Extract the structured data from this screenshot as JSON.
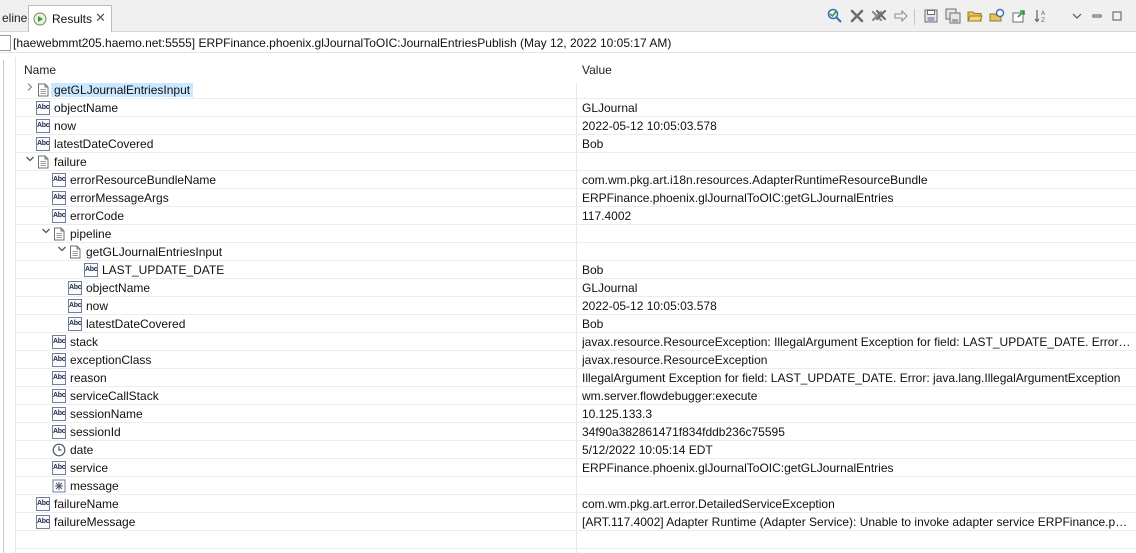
{
  "tabs": {
    "previous_label": "eline",
    "active_label": "Results",
    "close_glyph": "✕"
  },
  "path": {
    "text": "[haewebmmt205.haemo.net:5555] ERPFinance.phoenix.glJournalToOIC:JournalEntriesPublish (May 12, 2022 10:05:17 AM)"
  },
  "table": {
    "headers": {
      "name": "Name",
      "value": "Value"
    },
    "rows": [
      {
        "depth": 0,
        "twist": "collapsed",
        "icon": "document",
        "name": "getGLJournalEntriesInput",
        "value": "",
        "selected": true
      },
      {
        "depth": 0,
        "twist": "none",
        "icon": "abc",
        "name": "objectName",
        "value": "GLJournal"
      },
      {
        "depth": 0,
        "twist": "none",
        "icon": "abc",
        "name": "now",
        "value": "2022-05-12 10:05:03.578"
      },
      {
        "depth": 0,
        "twist": "none",
        "icon": "abc",
        "name": "latestDateCovered",
        "value": "Bob"
      },
      {
        "depth": 0,
        "twist": "expanded",
        "icon": "document",
        "name": "failure",
        "value": ""
      },
      {
        "depth": 1,
        "twist": "none",
        "icon": "abc",
        "name": "errorResourceBundleName",
        "value": "com.wm.pkg.art.i18n.resources.AdapterRuntimeResourceBundle"
      },
      {
        "depth": 1,
        "twist": "none",
        "icon": "abc",
        "name": "errorMessageArgs",
        "value": "ERPFinance.phoenix.glJournalToOIC:getGLJournalEntries"
      },
      {
        "depth": 1,
        "twist": "none",
        "icon": "abc",
        "name": "errorCode",
        "value": "117.4002"
      },
      {
        "depth": 1,
        "twist": "expanded",
        "icon": "document",
        "name": "pipeline",
        "value": ""
      },
      {
        "depth": 2,
        "twist": "expanded",
        "icon": "document",
        "name": "getGLJournalEntriesInput",
        "value": ""
      },
      {
        "depth": 3,
        "twist": "none",
        "icon": "abc",
        "name": "LAST_UPDATE_DATE",
        "value": "Bob"
      },
      {
        "depth": 2,
        "twist": "none",
        "icon": "abc",
        "name": "objectName",
        "value": "GLJournal"
      },
      {
        "depth": 2,
        "twist": "none",
        "icon": "abc",
        "name": "now",
        "value": "2022-05-12 10:05:03.578"
      },
      {
        "depth": 2,
        "twist": "none",
        "icon": "abc",
        "name": "latestDateCovered",
        "value": "Bob"
      },
      {
        "depth": 1,
        "twist": "none",
        "icon": "abc",
        "name": "stack",
        "value": "javax.resource.ResourceException: IllegalArgument Exception for field: LAST_UPDATE_DATE. Error: java.lang.IllegalArgumentException"
      },
      {
        "depth": 1,
        "twist": "none",
        "icon": "abc",
        "name": "exceptionClass",
        "value": "javax.resource.ResourceException"
      },
      {
        "depth": 1,
        "twist": "none",
        "icon": "abc",
        "name": "reason",
        "value": "IllegalArgument Exception for field: LAST_UPDATE_DATE. Error: java.lang.IllegalArgumentException"
      },
      {
        "depth": 1,
        "twist": "none",
        "icon": "abc",
        "name": "serviceCallStack",
        "value": "wm.server.flowdebugger:execute"
      },
      {
        "depth": 1,
        "twist": "none",
        "icon": "abc",
        "name": "sessionName",
        "value": "10.125.133.3"
      },
      {
        "depth": 1,
        "twist": "none",
        "icon": "abc",
        "name": "sessionId",
        "value": "34f90a382861471f834fddb236c75595"
      },
      {
        "depth": 1,
        "twist": "none",
        "icon": "clock",
        "name": "date",
        "value": "5/12/2022 10:05:14  EDT"
      },
      {
        "depth": 1,
        "twist": "none",
        "icon": "abc",
        "name": "service",
        "value": "ERPFinance.phoenix.glJournalToOIC:getGLJournalEntries"
      },
      {
        "depth": 1,
        "twist": "none",
        "icon": "object",
        "name": "message",
        "value": ""
      },
      {
        "depth": 0,
        "twist": "none",
        "icon": "abc",
        "name": "failureName",
        "value": "com.wm.pkg.art.error.DetailedServiceException"
      },
      {
        "depth": 0,
        "twist": "none",
        "icon": "abc",
        "name": "failureMessage",
        "value": "[ART.117.4002] Adapter Runtime (Adapter Service): Unable to invoke adapter service ERPFinance.phoenix.glJournalToOIC:getGLJournalEntries."
      },
      {
        "depth": 0,
        "twist": "none",
        "icon": "none",
        "name": "",
        "value": ""
      }
    ]
  },
  "toolbar_icons": [
    "run-check-icon",
    "remove-icon",
    "remove-all-icon",
    "forward-arrow-icon",
    "save-icon",
    "save-all-icon",
    "open-folder-icon",
    "restore-icon",
    "export-icon",
    "sort-icon",
    "view-menu-icon",
    "minimize-icon",
    "maximize-icon"
  ],
  "colors": {
    "selection": "#cce8ff",
    "tab_bg": "#f0f0f0",
    "icon_green": "#3a9a3a"
  }
}
